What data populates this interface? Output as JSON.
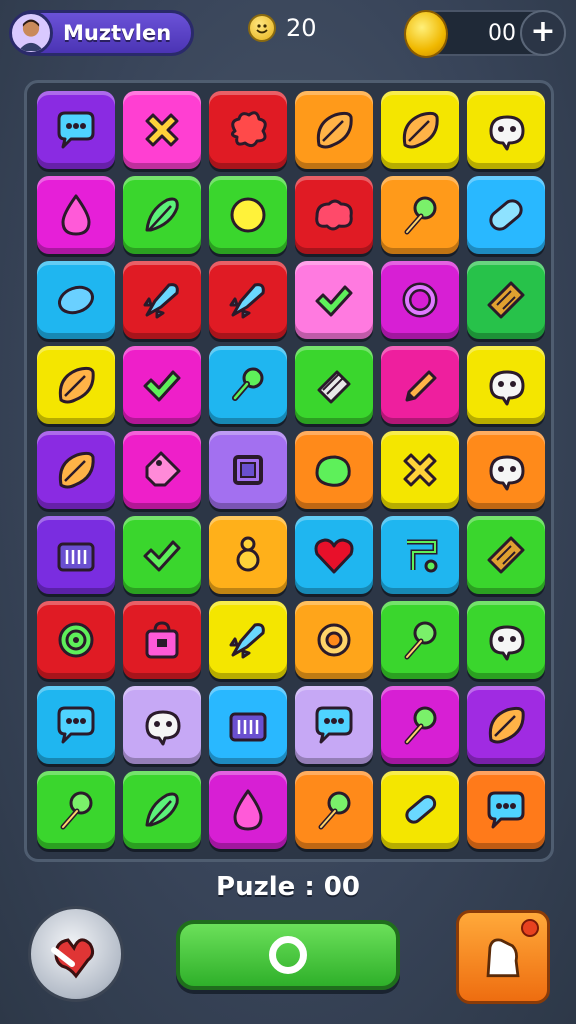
{
  "player": {
    "name": "Muztvlen"
  },
  "lives": {
    "value": "20"
  },
  "coins": {
    "value": "00"
  },
  "puzzle_label": "Puzle : 00",
  "board": [
    {
      "color": "#8a2be2",
      "icon": "chat-bubble-icon"
    },
    {
      "color": "#ff3fd2",
      "icon": "cross-icon"
    },
    {
      "color": "#e01b24",
      "icon": "splat-icon"
    },
    {
      "color": "#ff9a1a",
      "icon": "leaf-icon"
    },
    {
      "color": "#f4e600",
      "icon": "leaf-icon"
    },
    {
      "color": "#f4e600",
      "icon": "creature-icon"
    },
    {
      "color": "#e61fd8",
      "icon": "drop-icon"
    },
    {
      "color": "#3ad62d",
      "icon": "feather-icon"
    },
    {
      "color": "#3ad62d",
      "icon": "circle-icon"
    },
    {
      "color": "#e01b24",
      "icon": "blob-icon"
    },
    {
      "color": "#ff9a1a",
      "icon": "flower-icon"
    },
    {
      "color": "#29b8ff",
      "icon": "capsule-icon"
    },
    {
      "color": "#1fb6f0",
      "icon": "lemon-icon"
    },
    {
      "color": "#e01b24",
      "icon": "rocket-icon"
    },
    {
      "color": "#e01b24",
      "icon": "rocket-icon"
    },
    {
      "color": "#ff7ae0",
      "icon": "check-icon"
    },
    {
      "color": "#d71fd4",
      "icon": "ring-icon"
    },
    {
      "color": "#27c24a",
      "icon": "wood-icon"
    },
    {
      "color": "#f4e600",
      "icon": "leaf-icon"
    },
    {
      "color": "#ee1fc9",
      "icon": "check-icon"
    },
    {
      "color": "#1fb6f0",
      "icon": "key-icon"
    },
    {
      "color": "#3ad62d",
      "icon": "scroll-icon"
    },
    {
      "color": "#ee1f9e",
      "icon": "pencil-icon"
    },
    {
      "color": "#f4e600",
      "icon": "creature-icon"
    },
    {
      "color": "#8a2be2",
      "icon": "leaf-icon"
    },
    {
      "color": "#ee1fc9",
      "icon": "tag-icon"
    },
    {
      "color": "#a370f0",
      "icon": "square-icon"
    },
    {
      "color": "#ff8a1a",
      "icon": "lime-icon"
    },
    {
      "color": "#f4e600",
      "icon": "cross-icon"
    },
    {
      "color": "#ff8a1a",
      "icon": "creature-icon"
    },
    {
      "color": "#7a2de0",
      "icon": "basket-icon"
    },
    {
      "color": "#3ad62d",
      "icon": "check-icon"
    },
    {
      "color": "#ffb01a",
      "icon": "eight-icon"
    },
    {
      "color": "#1fb6f0",
      "icon": "heart-icon"
    },
    {
      "color": "#1fb6f0",
      "icon": "music-icon"
    },
    {
      "color": "#3ad62d",
      "icon": "wood-icon"
    },
    {
      "color": "#e01b24",
      "icon": "target-icon"
    },
    {
      "color": "#e01b24",
      "icon": "bag-icon"
    },
    {
      "color": "#f4e600",
      "icon": "rocket-icon"
    },
    {
      "color": "#ffa51a",
      "icon": "gear-icon"
    },
    {
      "color": "#3ad62d",
      "icon": "flower-icon"
    },
    {
      "color": "#3ad62d",
      "icon": "creature-icon"
    },
    {
      "color": "#1fb6f0",
      "icon": "chat-bubble-icon"
    },
    {
      "color": "#c6a8f5",
      "icon": "creature-icon"
    },
    {
      "color": "#29b8ff",
      "icon": "basket-icon"
    },
    {
      "color": "#c6a8f5",
      "icon": "chat-bubble-icon"
    },
    {
      "color": "#d71fd4",
      "icon": "flower-icon"
    },
    {
      "color": "#a02be2",
      "icon": "leaf-icon"
    },
    {
      "color": "#3ad62d",
      "icon": "flower-icon"
    },
    {
      "color": "#3ad62d",
      "icon": "feather-icon"
    },
    {
      "color": "#d71fd4",
      "icon": "drop-icon"
    },
    {
      "color": "#ff8a1a",
      "icon": "flower-icon"
    },
    {
      "color": "#f4e600",
      "icon": "clip-icon"
    },
    {
      "color": "#ff7a1a",
      "icon": "chat-bubble-icon"
    }
  ]
}
